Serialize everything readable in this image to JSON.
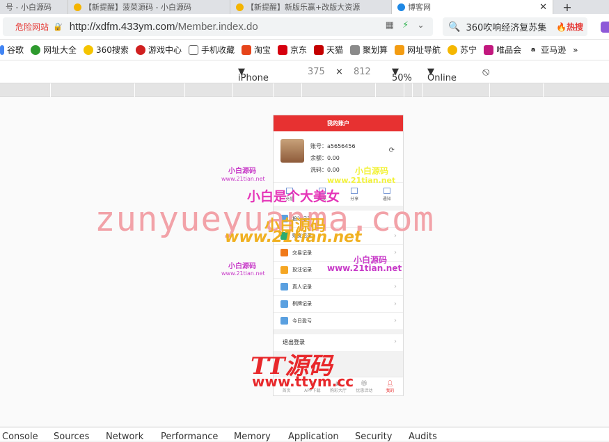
{
  "tabs": [
    {
      "label": "号 - 小白源码"
    },
    {
      "label": "【新提醒】菠菜源码 - 小白源码"
    },
    {
      "label": "【新提醒】新版乐赢+改版大资源"
    },
    {
      "label": "博客网"
    }
  ],
  "address": {
    "danger_label": "危险网站",
    "url_host": "http://xdfm.433ym.com",
    "url_path": "/Member.index.do"
  },
  "search": {
    "text": "360吹响经济复苏集",
    "hot_label": "热搜"
  },
  "bookmarks": [
    "谷歌",
    "网址大全",
    "360搜索",
    "游戏中心",
    "手机收藏",
    "淘宝",
    "京东",
    "天猫",
    "聚划算",
    "网址导航",
    "苏宁",
    "唯品会",
    "亚马逊"
  ],
  "device": {
    "name": "iPhone X",
    "width": "375",
    "height": "812",
    "zoom": "50%",
    "network": "Online"
  },
  "phone": {
    "header_title": "我的账户",
    "account_label": "账号：a5656456",
    "balance_label": "余额：0.00",
    "wash_label": "洗码：0.00",
    "quick": [
      "充值",
      "提现",
      "分享",
      "通知"
    ],
    "menu": [
      "投注记录",
      "账变记录",
      "交易记录",
      "投注记录",
      "真人记录",
      "棋牌记录",
      "今日盈亏"
    ],
    "logout_label": "退出登录",
    "nav": [
      "首页",
      "APP下载",
      "购彩大厅",
      "优惠活动",
      "我的"
    ]
  },
  "watermarks": {
    "main": "zunyueyuanma.com",
    "xb1": "小白源码",
    "xb1_url": "www.21tian.net",
    "xb_big": "小白是个大美女",
    "xb_mid": "小白源码",
    "xb_mid_url": "www.21tian.net",
    "tt": "TT源码",
    "tt_url": "www.ttym.cc"
  },
  "devtools_tabs": [
    "Console",
    "Sources",
    "Network",
    "Performance",
    "Memory",
    "Application",
    "Security",
    "Audits"
  ]
}
